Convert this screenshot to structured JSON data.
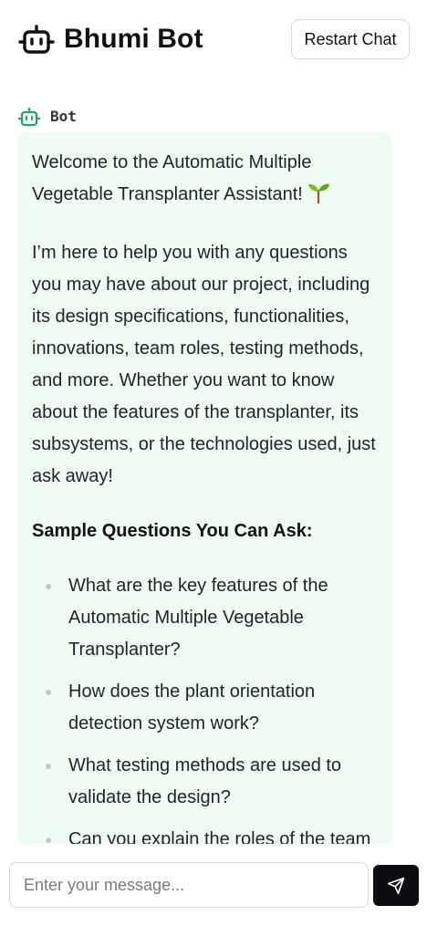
{
  "header": {
    "title": "Bhumi Bot",
    "restart_label": "Restart Chat",
    "logo_icon": "robot-icon"
  },
  "chat": {
    "sender_label": "Bot",
    "sender_icon": "robot-icon",
    "message": {
      "intro": "Welcome to the Automatic Multiple Vegetable Transplanter Assistant!",
      "intro_emoji": "seedling-icon",
      "body": "I’m here to help you with any questions you may have about our project, including its design specifications, functionalities, innovations, team roles, testing methods, and more. Whether you want to know about the features of the transplanter, its subsystems, or the technologies used, just ask away!",
      "questions_heading": "Sample Questions You Can Ask:",
      "questions": [
        "What are the key features of the Automatic Multiple Vegetable Transplanter?",
        "How does the plant orientation detection system work?",
        "What testing methods are used to validate the design?",
        "Can you explain the roles of the team"
      ]
    }
  },
  "composer": {
    "placeholder": "Enter your message...",
    "value": "",
    "send_icon": "send-icon"
  },
  "colors": {
    "accent": "#22a45d",
    "bubble_bg": "#effcf4",
    "send_bg": "#0b0d10"
  }
}
